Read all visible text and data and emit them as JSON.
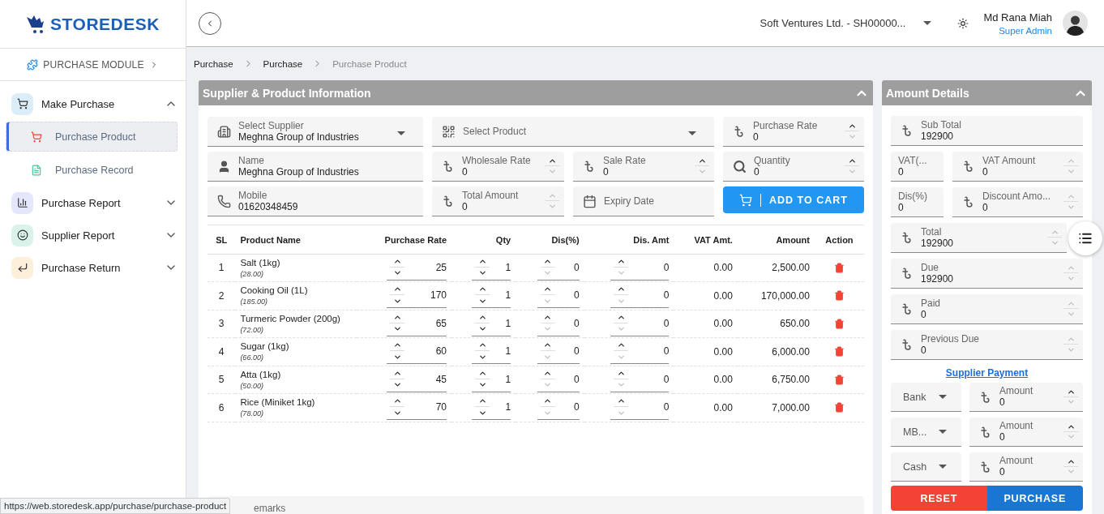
{
  "sidebar": {
    "logo": "STOREDESK",
    "module": "PURCHASE MODULE",
    "items": [
      {
        "label": "Make Purchase",
        "color": "#dcedfa",
        "expanded": true,
        "children": [
          {
            "label": "Purchase Product",
            "selected": true
          },
          {
            "label": "Purchase Record",
            "selected": false
          }
        ]
      },
      {
        "label": "Purchase Report",
        "color": "#e4e6fb",
        "expanded": false
      },
      {
        "label": "Supplier Report",
        "color": "#d9f3ea",
        "expanded": false
      },
      {
        "label": "Purchase Return",
        "color": "#fdefd9",
        "expanded": false
      }
    ]
  },
  "header": {
    "company": "Soft Ventures Ltd. - SH00000...",
    "user": "Md Rana Miah",
    "role": "Super Admin"
  },
  "breadcrumb": [
    {
      "label": "Purchase",
      "current": false
    },
    {
      "label": "Purchase",
      "current": false
    },
    {
      "label": "Purchase Product",
      "current": true
    }
  ],
  "supplier_panel": {
    "title": "Supplier & Product Information",
    "expanded": true,
    "fields": [
      {
        "kind": "select",
        "label": "Select Supplier",
        "value": "Meghna Group of Industries"
      },
      {
        "kind": "select",
        "placeholder": "Select Product"
      },
      {
        "kind": "number",
        "label": "Purchase Rate",
        "value": "0",
        "up": true,
        "down": false
      },
      {
        "kind": "text",
        "label": "Name",
        "value": "Meghna Group of Industries"
      },
      {
        "kind": "number",
        "label": "Wholesale Rate",
        "value": "0",
        "up": true,
        "down": false
      },
      {
        "kind": "number",
        "label": "Sale Rate",
        "value": "0",
        "up": true,
        "down": false
      },
      {
        "kind": "number",
        "label": "Quantity",
        "value": "0",
        "up": true,
        "down": false
      },
      {
        "kind": "text",
        "label": "Mobile",
        "value": "01620348459"
      },
      {
        "kind": "number",
        "label": "Total Amount",
        "value": "0",
        "up": false,
        "down": false
      },
      {
        "kind": "date",
        "placeholder": "Expiry Date"
      },
      {
        "kind": "button",
        "label": "ADD TO CART"
      }
    ],
    "columns": [
      {
        "label": "SL",
        "kind": "text"
      },
      {
        "label": "Product Name",
        "kind": "text"
      },
      {
        "label": "Purchase Rate",
        "kind": "stepper",
        "up": true,
        "down": true
      },
      {
        "label": "Qty",
        "kind": "stepper",
        "up": true,
        "down": true
      },
      {
        "label": "Dis(%)",
        "kind": "stepper",
        "up": true,
        "down": false
      },
      {
        "label": "Dis. Amt",
        "kind": "stepper",
        "up": true,
        "down": false
      },
      {
        "label": "VAT Amt.",
        "kind": "text"
      },
      {
        "label": "Amount",
        "kind": "text"
      },
      {
        "label": "Action",
        "kind": "action"
      }
    ],
    "rows": [
      {
        "sl": "1",
        "name": "Salt (1kg)",
        "price": "(28.00)",
        "rate": "25",
        "qty": "1",
        "dis": "0",
        "dis_amt": "0",
        "vat": "0.00",
        "amount": "2,500.00"
      },
      {
        "sl": "2",
        "name": "Cooking Oil (1L)",
        "price": "(185.00)",
        "rate": "170",
        "qty": "1",
        "dis": "0",
        "dis_amt": "0",
        "vat": "0.00",
        "amount": "170,000.00"
      },
      {
        "sl": "3",
        "name": "Turmeric Powder (200g)",
        "price": "(72.00)",
        "rate": "65",
        "qty": "1",
        "dis": "0",
        "dis_amt": "0",
        "vat": "0.00",
        "amount": "650.00"
      },
      {
        "sl": "4",
        "name": "Sugar (1kg)",
        "price": "(66.00)",
        "rate": "60",
        "qty": "1",
        "dis": "0",
        "dis_amt": "0",
        "vat": "0.00",
        "amount": "6,000.00"
      },
      {
        "sl": "5",
        "name": "Atta (1kg)",
        "price": "(50.00)",
        "rate": "45",
        "qty": "1",
        "dis": "0",
        "dis_amt": "0",
        "vat": "0.00",
        "amount": "6,750.00"
      },
      {
        "sl": "6",
        "name": "Rice (Miniket 1kg)",
        "price": "(78.00)",
        "rate": "70",
        "qty": "1",
        "dis": "0",
        "dis_amt": "0",
        "vat": "0.00",
        "amount": "7,000.00"
      }
    ],
    "remarks": {
      "label": "emarks"
    }
  },
  "amount_panel": {
    "title": "Amount Details",
    "expanded": true,
    "rows": [
      {
        "fields": [
          {
            "kind": "money",
            "label": "Sub Total",
            "value": "192900"
          }
        ]
      },
      {
        "fields": [
          {
            "kind": "percent",
            "label": "VAT(...",
            "value": "0"
          },
          {
            "kind": "money_stepper",
            "label": "VAT Amount",
            "value": "0",
            "up": false,
            "down": false
          }
        ]
      },
      {
        "fields": [
          {
            "kind": "percent",
            "label": "Dis(%)",
            "value": "0"
          },
          {
            "kind": "money_stepper",
            "label": "Discount Amo...",
            "value": "0",
            "up": false,
            "down": false
          }
        ]
      },
      {
        "fields": [
          {
            "kind": "money_stepper",
            "label": "Total",
            "value": "192900",
            "up": false,
            "down": false
          }
        ]
      },
      {
        "fields": [
          {
            "kind": "money_stepper",
            "label": "Due",
            "value": "192900",
            "up": false,
            "down": false
          }
        ]
      },
      {
        "fields": [
          {
            "kind": "money_stepper",
            "label": "Paid",
            "value": "0",
            "up": false,
            "down": false
          }
        ]
      },
      {
        "fields": [
          {
            "kind": "money_stepper",
            "label": "Previous Due",
            "value": "0",
            "up": false,
            "down": false
          }
        ]
      }
    ],
    "link": "Supplier Payment",
    "payments": [
      {
        "method": "Bank",
        "label": "Amount",
        "value": "0",
        "up": true,
        "down": false
      },
      {
        "method": "MB...",
        "label": "Amount",
        "value": "0",
        "up": true,
        "down": false
      },
      {
        "method": "Cash",
        "label": "Amount",
        "value": "0",
        "up": true,
        "down": false
      }
    ],
    "buttons": [
      {
        "kind": "reset",
        "label": "RESET"
      },
      {
        "kind": "submit",
        "label": "PURCHASE"
      }
    ]
  },
  "status_url": "https://web.storedesk.app/purchase/purchase-product"
}
